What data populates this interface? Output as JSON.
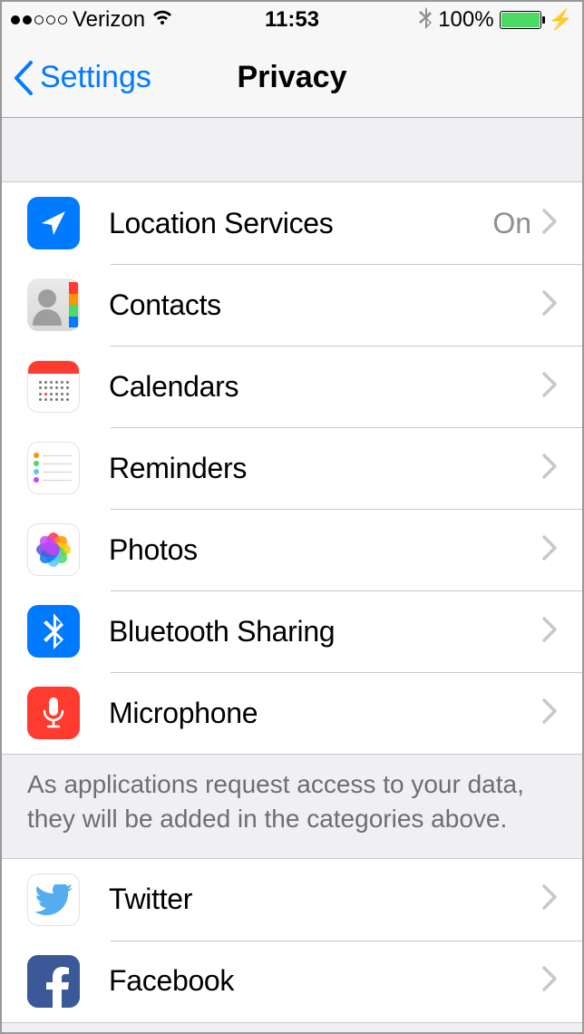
{
  "status": {
    "carrier": "Verizon",
    "time": "11:53",
    "battery_pct": "100%"
  },
  "nav": {
    "back_label": "Settings",
    "title": "Privacy"
  },
  "section1": {
    "rows": [
      {
        "label": "Location Services",
        "value": "On",
        "icon": "location-icon"
      },
      {
        "label": "Contacts",
        "value": "",
        "icon": "contacts-icon"
      },
      {
        "label": "Calendars",
        "value": "",
        "icon": "calendars-icon"
      },
      {
        "label": "Reminders",
        "value": "",
        "icon": "reminders-icon"
      },
      {
        "label": "Photos",
        "value": "",
        "icon": "photos-icon"
      },
      {
        "label": "Bluetooth Sharing",
        "value": "",
        "icon": "bluetooth-icon"
      },
      {
        "label": "Microphone",
        "value": "",
        "icon": "microphone-icon"
      }
    ]
  },
  "section1_footer": "As applications request access to your data, they will be added in the categories above.",
  "section2": {
    "rows": [
      {
        "label": "Twitter",
        "value": "",
        "icon": "twitter-icon"
      },
      {
        "label": "Facebook",
        "value": "",
        "icon": "facebook-icon"
      }
    ]
  }
}
